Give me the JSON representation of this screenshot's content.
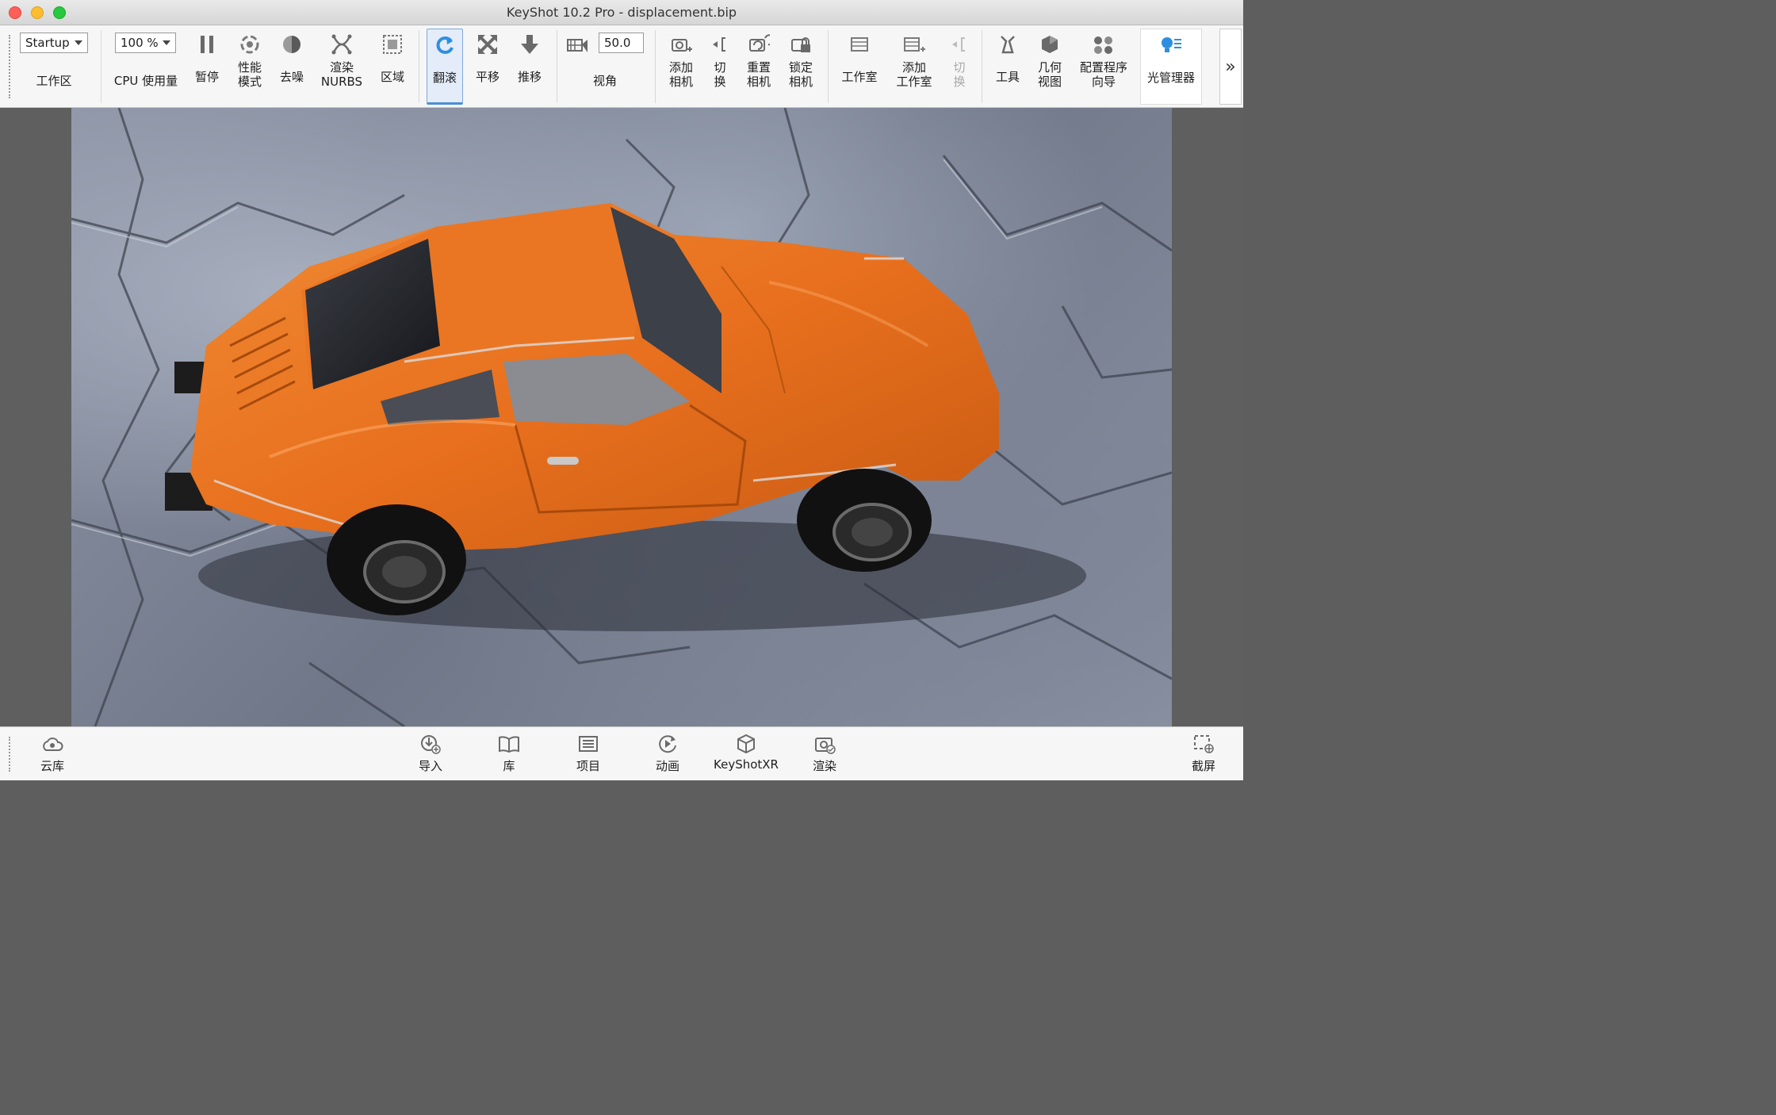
{
  "window": {
    "title": "KeyShot 10.2 Pro  - displacement.bip"
  },
  "ribbon": {
    "workspace": {
      "value": "Startup",
      "label": "工作区"
    },
    "cpu": {
      "value": "100 %",
      "label": "CPU 使用量"
    },
    "pause": "暂停",
    "performance": "性能\n模式",
    "denoise": "去噪",
    "render_nurbs": "渲染\nNURBS",
    "region": "区域",
    "tumble": "翻滚",
    "pan": "平移",
    "dolly": "推移",
    "fov": {
      "value": "50.0",
      "label": "视角"
    },
    "add_camera": "添加\n相机",
    "switch_camera": "切\n换",
    "reset_camera": "重置\n相机",
    "lock_camera": "锁定\n相机",
    "studio": "工作室",
    "add_studio": "添加\n工作室",
    "switch_studio": "切\n换",
    "tools": "工具",
    "geometry_view": "几何\n视图",
    "configurator_wizard": "配置程序\n向导",
    "light_manager": "光管理器",
    "more": "»"
  },
  "bottom": {
    "cloud_library": "云库",
    "import": "导入",
    "library": "库",
    "project": "项目",
    "animation": "动画",
    "keyshotxr": "KeyShotXR",
    "render": "渲染",
    "screenshot": "截屏"
  },
  "colors": {
    "car_body": "#e8701e",
    "accent_blue": "#2e8fe0",
    "active_bg": "#e3ecf8"
  }
}
